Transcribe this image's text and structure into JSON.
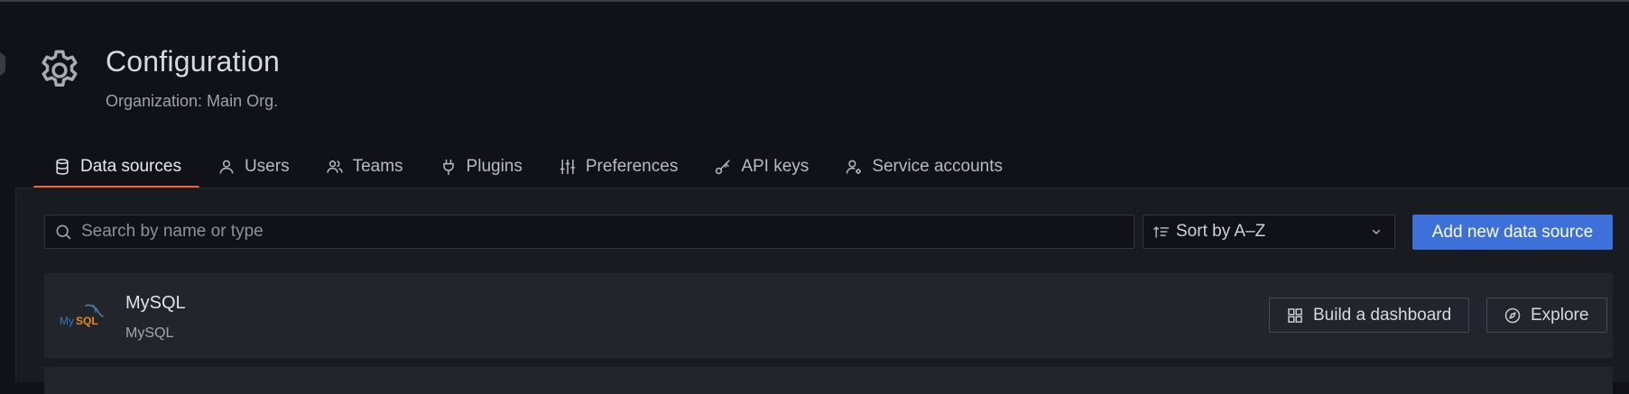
{
  "header": {
    "title": "Configuration",
    "subtitle": "Organization: Main Org.",
    "icon": "gear-icon"
  },
  "tabs": [
    {
      "label": "Data sources",
      "icon": "database-icon",
      "active": true
    },
    {
      "label": "Users",
      "icon": "user-icon",
      "active": false
    },
    {
      "label": "Teams",
      "icon": "users-icon",
      "active": false
    },
    {
      "label": "Plugins",
      "icon": "plug-icon",
      "active": false
    },
    {
      "label": "Preferences",
      "icon": "sliders-icon",
      "active": false
    },
    {
      "label": "API keys",
      "icon": "key-icon",
      "active": false
    },
    {
      "label": "Service accounts",
      "icon": "user-cog-icon",
      "active": false
    }
  ],
  "toolbar": {
    "search_placeholder": "Search by name or type",
    "search_value": "",
    "sort_label": "Sort by A–Z",
    "add_label": "Add new data source"
  },
  "datasources": [
    {
      "name": "MySQL",
      "type": "MySQL",
      "logo": "mysql-logo",
      "build_label": "Build a dashboard",
      "explore_label": "Explore"
    }
  ],
  "colors": {
    "background": "#111217",
    "panel": "#181b1f",
    "card": "#22252b",
    "accent_underline": "#f55f3e",
    "primary_button": "#3d71d9"
  }
}
